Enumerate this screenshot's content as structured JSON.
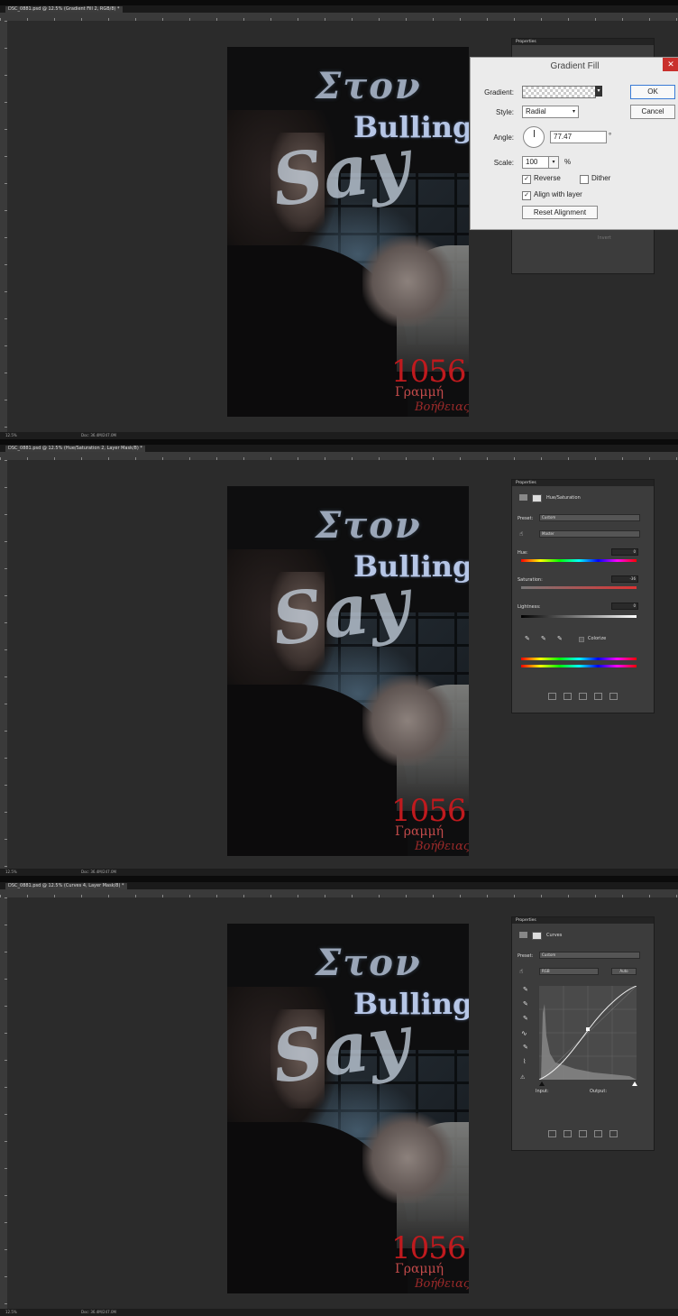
{
  "panels": [
    {
      "tab": "DSC_0881.psd @ 12.5% (Gradient Fill 2, RGB/8) *",
      "status": {
        "zoom": "12.5%",
        "doc": "Doc: 36.4M/247.0M"
      }
    },
    {
      "tab": "DSC_0881.psd @ 12.5% (Hue/Saturation 2, Layer Mask/8) *",
      "status": {
        "zoom": "12.5%",
        "doc": "Doc: 36.4M/247.0M"
      }
    },
    {
      "tab": "DSC_0881.psd @ 12.5% (Curves 4, Layer Mask/8) *",
      "status": {
        "zoom": "12.5%",
        "doc": "Doc: 36.4M/247.0M"
      }
    }
  ],
  "poster": {
    "title_line1": "Στον",
    "title_line2": "Bulling",
    "scrawl": "Say",
    "number": "1056",
    "greek1": "Γραμμή",
    "greek2": "Βοήθειας"
  },
  "gradient_dialog": {
    "title": "Gradient Fill",
    "gradient_label": "Gradient:",
    "style_label": "Style:",
    "style_value": "Radial",
    "angle_label": "Angle:",
    "angle_value": "77.47",
    "angle_unit": "°",
    "scale_label": "Scale:",
    "scale_value": "100",
    "scale_unit": "%",
    "reverse_label": "Reverse",
    "reverse_checked": true,
    "dither_label": "Dither",
    "dither_checked": false,
    "align_label": "Align with layer",
    "align_checked": true,
    "reset_label": "Reset Alignment",
    "ok_label": "OK",
    "cancel_label": "Cancel"
  },
  "properties_top": {
    "title": "Properties",
    "hidden_button": "Invert"
  },
  "hue_sat": {
    "title": "Properties",
    "adjustment": "Hue/Saturation",
    "preset_label": "Preset:",
    "preset_value": "Custom",
    "channel_value": "Master",
    "hue_label": "Hue:",
    "hue_value": "0",
    "sat_label": "Saturation:",
    "sat_value": "-36",
    "light_label": "Lightness:",
    "light_value": "0",
    "colorize_label": "Colorize"
  },
  "curves": {
    "title": "Properties",
    "adjustment": "Curves",
    "preset_label": "Preset:",
    "preset_value": "Custom",
    "channel_value": "RGB",
    "auto_label": "Auto",
    "input_label": "Input:",
    "output_label": "Output:"
  }
}
